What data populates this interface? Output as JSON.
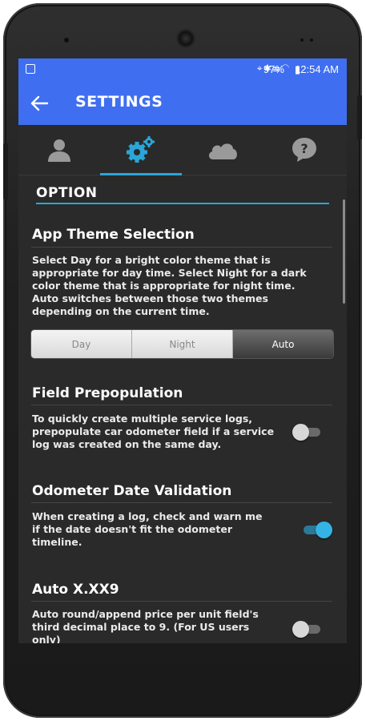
{
  "status_bar": {
    "battery_pct": "97%",
    "time": "12:54 AM",
    "icons": [
      "location-icon",
      "bluetooth-icon",
      "nfc-icon",
      "wifi-icon"
    ]
  },
  "appbar": {
    "title": "SETTINGS"
  },
  "tabs": [
    {
      "name": "profile",
      "icon": "person-icon"
    },
    {
      "name": "settings",
      "icon": "gears-icon",
      "selected": true
    },
    {
      "name": "cloud",
      "icon": "cloud-icon"
    },
    {
      "name": "help",
      "icon": "help-icon"
    }
  ],
  "section": {
    "heading": "OPTION"
  },
  "prefs": {
    "theme": {
      "title": "App Theme Selection",
      "desc": "Select Day for a bright color theme that is appropriate for day time. Select Night for a dark color theme that is appropriate for night time. Auto switches between those two themes depending on the current time.",
      "options": [
        "Day",
        "Night",
        "Auto"
      ],
      "selected": "Auto"
    },
    "prepop": {
      "title": "Field Prepopulation",
      "desc": "To quickly create multiple service logs, prepopulate car odometer field if a service log was created on the same day.",
      "enabled": false
    },
    "odo": {
      "title": "Odometer Date Validation",
      "desc": "When creating a log, check and warn me if the date doesn't fit the odometer timeline.",
      "enabled": true
    },
    "autoxxx9": {
      "title": "Auto X.XX9",
      "desc": "Auto round/append price per unit field's third decimal place to 9. (For US users only)",
      "enabled": false
    }
  },
  "colors": {
    "accent": "#3f6ff0",
    "highlight": "#2aa6d9",
    "background": "#2a2a2a"
  }
}
